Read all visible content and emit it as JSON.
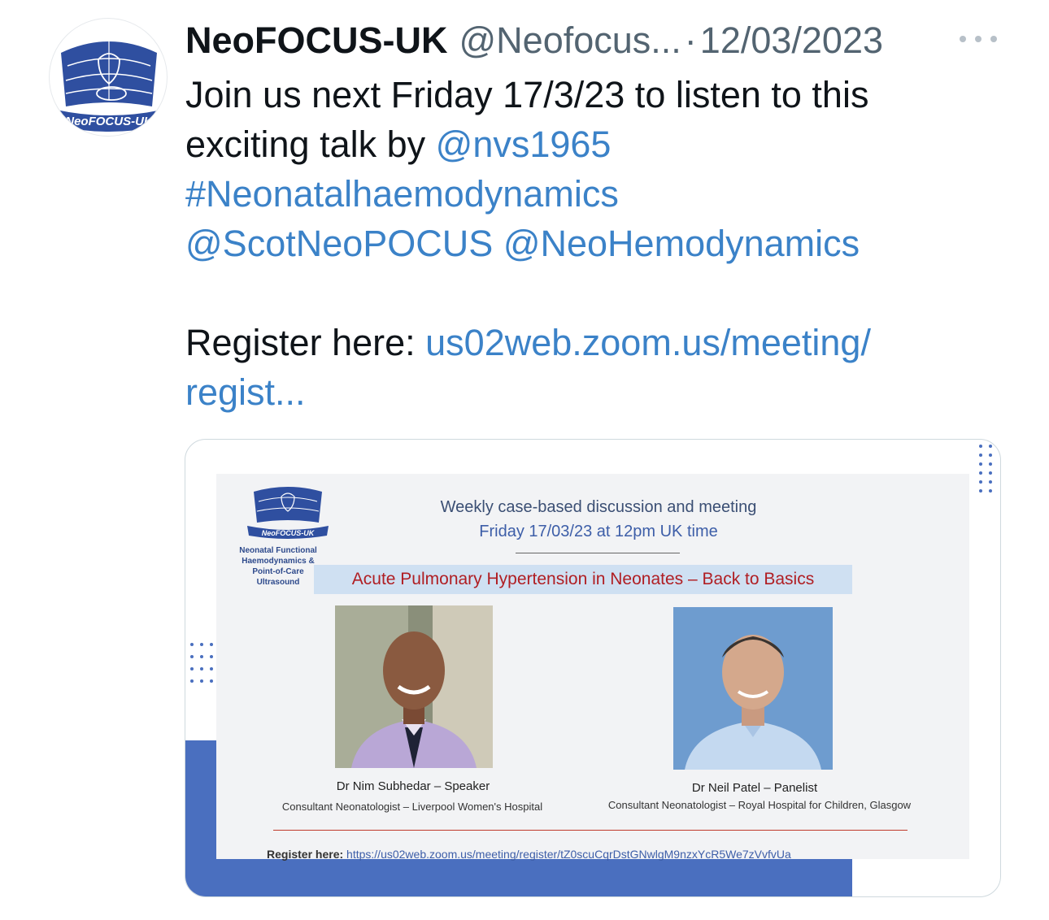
{
  "author": {
    "display_name": "NeoFOCUS-UK",
    "handle": "@Neofocus...",
    "separator": "·",
    "date": "12/03/2023",
    "avatar_text": "NeoFOCUS-UK"
  },
  "more_icon": "more-horizontal-icon",
  "tweet": {
    "line1": "Join us next Friday 17/3/23 to listen to this",
    "line2_text": "exciting talk by ",
    "mention_nvs": "@nvs1965",
    "hashtag": "#Neonatalhaemodynamics",
    "mention_scot": "@ScotNeoPOCUS",
    "mention_neohemo": "@NeoHemodynamics",
    "register_label": "Register here: ",
    "register_link_line1": "us02web.zoom.us/meeting/",
    "register_link_line2": "regist..."
  },
  "media": {
    "logo_caption_lines": [
      "Neonatal Functional",
      "Haemodynamics &",
      "Point-of-Care",
      "Ultrasound"
    ],
    "logo_text": "NeoFOCUS-UK",
    "meeting_title": "Weekly case-based discussion and meeting",
    "meeting_date": "Friday 17/03/23 at 12pm UK time",
    "talk_title": "Acute Pulmonary Hypertension in Neonates – Back to Basics",
    "speaker_name": "Dr Nim Subhedar – Speaker",
    "speaker_role": "Consultant Neonatologist – Liverpool  Women's Hospital",
    "panelist_name": "Dr Neil Patel – Panelist",
    "panelist_role": "Consultant Neonatologist – Royal Hospital for Children, Glasgow",
    "register_label": "Register here:",
    "register_url": "https://us02web.zoom.us/meeting/register/tZ0scuCqrDstGNwlgM9nzxYcR5We7zVvfvUa"
  },
  "colors": {
    "link": "#3b82c8",
    "brand_blue": "#4a6fbf",
    "banner_red": "#b01e23"
  }
}
